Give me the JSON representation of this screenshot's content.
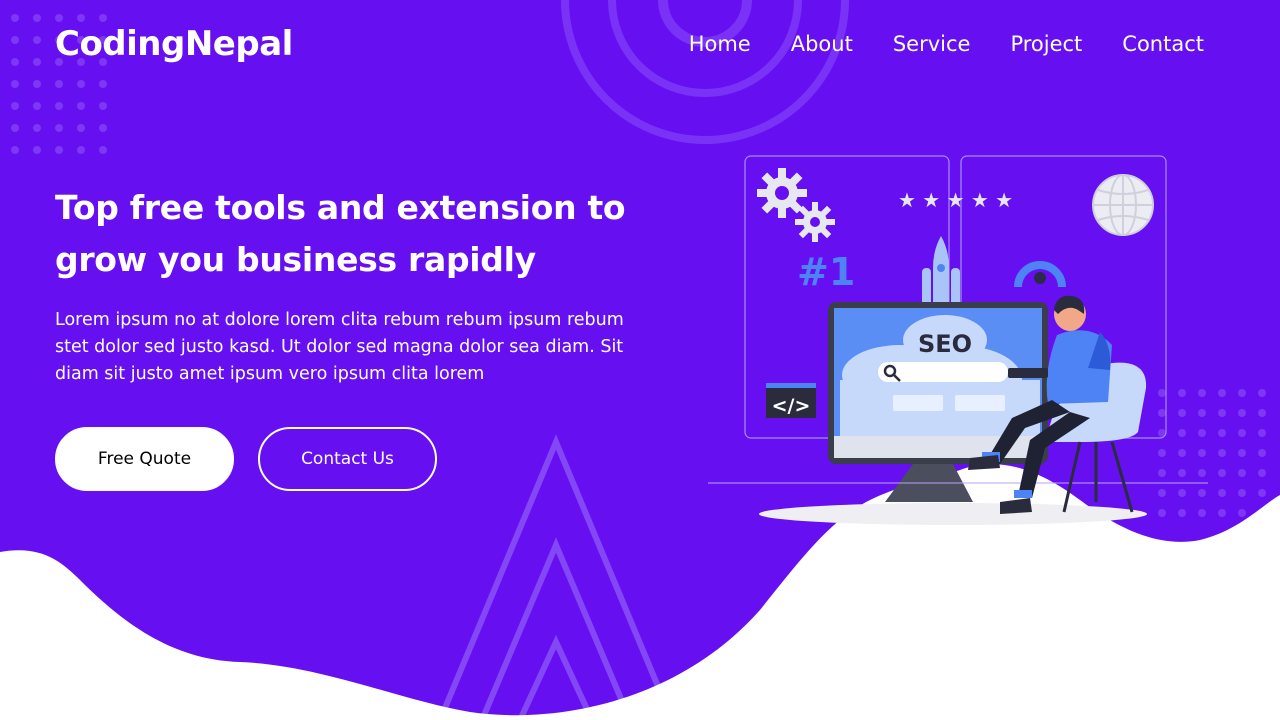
{
  "brand": {
    "name": "CodingNepal"
  },
  "nav": {
    "items": [
      {
        "label": "Home"
      },
      {
        "label": "About"
      },
      {
        "label": "Service"
      },
      {
        "label": "Project"
      },
      {
        "label": "Contact"
      }
    ]
  },
  "hero": {
    "title": "Top free tools and extension to grow you business rapidly",
    "description": "Lorem ipsum no at dolore lorem clita rebum rebum ipsum rebum stet dolor sed justo kasd. Ut dolor sed magna dolor sea diam. Sit diam sit justo amet ipsum vero ipsum clita lorem",
    "primary_button": "Free Quote",
    "secondary_button": "Contact Us"
  },
  "illustration": {
    "badge": "SEO",
    "rank": "#1",
    "code_tag": "</>",
    "stars": "★ ★ ★ ★ ★"
  },
  "colors": {
    "background": "#6610f2",
    "accent": "#ffffff",
    "illustration_blue": "#4e83f5"
  },
  "icons": [
    "gear-icon",
    "globe-icon",
    "rocket-icon",
    "search-icon",
    "code-icon",
    "star-icon"
  ]
}
